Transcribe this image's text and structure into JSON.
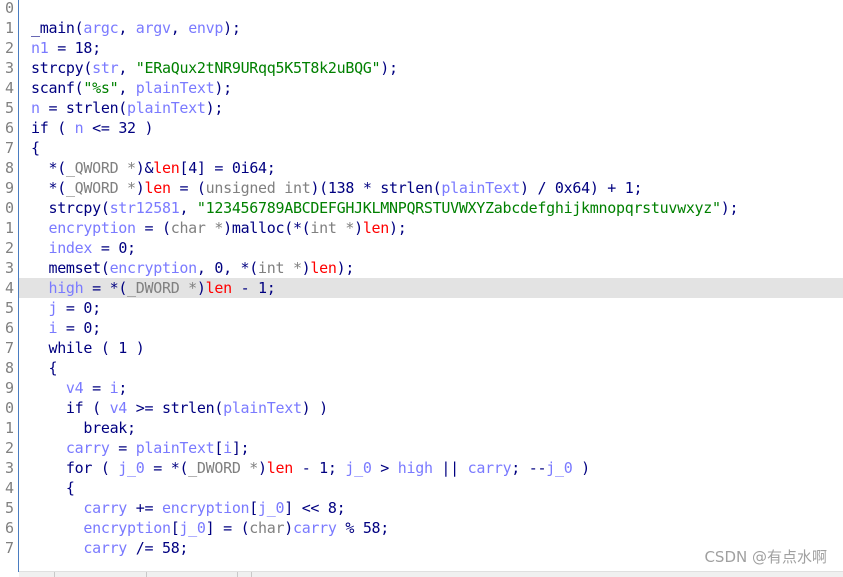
{
  "highlighted_line": 14,
  "colors": {
    "keyword": "#000080",
    "variable": "#7a7aff",
    "string": "#008000",
    "type": "#808080",
    "global": "#ff0000",
    "highlight": "#e3e3e3"
  },
  "line_numbers": [
    "0",
    "1",
    "2",
    "3",
    "4",
    "5",
    "6",
    "7",
    "8",
    "9",
    "0",
    "1",
    "2",
    "3",
    "4",
    "5",
    "6",
    "7",
    "8",
    "9",
    "0",
    "1",
    "2",
    "3",
    "4",
    "5",
    "6",
    "7"
  ],
  "lines": [
    [],
    [
      [
        "k",
        "_main("
      ],
      [
        "v",
        "argc"
      ],
      [
        "k",
        ", "
      ],
      [
        "v",
        "argv"
      ],
      [
        "k",
        ", "
      ],
      [
        "v",
        "envp"
      ],
      [
        "k",
        ");"
      ]
    ],
    [
      [
        "v",
        "n1"
      ],
      [
        "k",
        " = 18;"
      ]
    ],
    [
      [
        "k",
        "strcpy("
      ],
      [
        "v",
        "str"
      ],
      [
        "k",
        ", "
      ],
      [
        "s",
        "\"ERaQux2tNR9URqq5K5T8k2uBQG\""
      ],
      [
        "k",
        ");"
      ]
    ],
    [
      [
        "k",
        "scanf("
      ],
      [
        "s",
        "\"%s\""
      ],
      [
        "k",
        ", "
      ],
      [
        "v",
        "plainText"
      ],
      [
        "k",
        ");"
      ]
    ],
    [
      [
        "v",
        "n"
      ],
      [
        "k",
        " = strlen("
      ],
      [
        "v",
        "plainText"
      ],
      [
        "k",
        ");"
      ]
    ],
    [
      [
        "k",
        "if ( "
      ],
      [
        "v",
        "n"
      ],
      [
        "k",
        " <= 32 )"
      ]
    ],
    [
      [
        "k",
        "{"
      ]
    ],
    [
      [
        "k",
        "  *("
      ],
      [
        "g",
        "_QWORD *"
      ],
      [
        "k",
        ")&"
      ],
      [
        "r",
        "len"
      ],
      [
        "k",
        "[4] = 0i64;"
      ]
    ],
    [
      [
        "k",
        "  *("
      ],
      [
        "g",
        "_QWORD *"
      ],
      [
        "k",
        ")"
      ],
      [
        "r",
        "len"
      ],
      [
        "k",
        " = ("
      ],
      [
        "g",
        "unsigned int"
      ],
      [
        "k",
        ")(138 * strlen("
      ],
      [
        "v",
        "plainText"
      ],
      [
        "k",
        ") / 0x64) + 1;"
      ]
    ],
    [
      [
        "k",
        "  strcpy("
      ],
      [
        "v",
        "str12581"
      ],
      [
        "k",
        ", "
      ],
      [
        "s",
        "\"123456789ABCDEFGHJKLMNPQRSTUVWXYZabcdefghijkmnopqrstuvwxyz\""
      ],
      [
        "k",
        ");"
      ]
    ],
    [
      [
        "v",
        "  encryption"
      ],
      [
        "k",
        " = ("
      ],
      [
        "g",
        "char *"
      ],
      [
        "k",
        ")malloc(*("
      ],
      [
        "g",
        "int *"
      ],
      [
        "k",
        ")"
      ],
      [
        "r",
        "len"
      ],
      [
        "k",
        ");"
      ]
    ],
    [
      [
        "v",
        "  index"
      ],
      [
        "k",
        " = 0;"
      ]
    ],
    [
      [
        "k",
        "  memset("
      ],
      [
        "v",
        "encryption"
      ],
      [
        "k",
        ", 0, *("
      ],
      [
        "g",
        "int *"
      ],
      [
        "k",
        ")"
      ],
      [
        "r",
        "len"
      ],
      [
        "k",
        ");"
      ]
    ],
    [
      [
        "v",
        "  high"
      ],
      [
        "k",
        " = *("
      ],
      [
        "g",
        "_DWORD *"
      ],
      [
        "k",
        ")"
      ],
      [
        "r",
        "len"
      ],
      [
        "k",
        " - 1;"
      ]
    ],
    [
      [
        "v",
        "  j"
      ],
      [
        "k",
        " = 0;"
      ]
    ],
    [
      [
        "v",
        "  i"
      ],
      [
        "k",
        " = 0;"
      ]
    ],
    [
      [
        "k",
        "  while ( 1 )"
      ]
    ],
    [
      [
        "k",
        "  {"
      ]
    ],
    [
      [
        "v",
        "    v4"
      ],
      [
        "k",
        " = "
      ],
      [
        "v",
        "i"
      ],
      [
        "k",
        ";"
      ]
    ],
    [
      [
        "k",
        "    if ( "
      ],
      [
        "v",
        "v4"
      ],
      [
        "k",
        " >= strlen("
      ],
      [
        "v",
        "plainText"
      ],
      [
        "k",
        ") )"
      ]
    ],
    [
      [
        "k",
        "      break;"
      ]
    ],
    [
      [
        "v",
        "    carry"
      ],
      [
        "k",
        " = "
      ],
      [
        "v",
        "plainText"
      ],
      [
        "k",
        "["
      ],
      [
        "v",
        "i"
      ],
      [
        "k",
        "];"
      ]
    ],
    [
      [
        "k",
        "    for ( "
      ],
      [
        "v",
        "j_0"
      ],
      [
        "k",
        " = *("
      ],
      [
        "g",
        "_DWORD *"
      ],
      [
        "k",
        ")"
      ],
      [
        "r",
        "len"
      ],
      [
        "k",
        " - 1; "
      ],
      [
        "v",
        "j_0"
      ],
      [
        "k",
        " > "
      ],
      [
        "v",
        "high"
      ],
      [
        "k",
        " || "
      ],
      [
        "v",
        "carry"
      ],
      [
        "k",
        "; --"
      ],
      [
        "v",
        "j_0"
      ],
      [
        "k",
        " )"
      ]
    ],
    [
      [
        "k",
        "    {"
      ]
    ],
    [
      [
        "v",
        "      carry"
      ],
      [
        "k",
        " += "
      ],
      [
        "v",
        "encryption"
      ],
      [
        "k",
        "["
      ],
      [
        "v",
        "j_0"
      ],
      [
        "k",
        "] << 8;"
      ]
    ],
    [
      [
        "v",
        "      encryption"
      ],
      [
        "k",
        "["
      ],
      [
        "v",
        "j_0"
      ],
      [
        "k",
        "] = ("
      ],
      [
        "g",
        "char"
      ],
      [
        "k",
        ")"
      ],
      [
        "v",
        "carry"
      ],
      [
        "k",
        " % 58;"
      ]
    ],
    [
      [
        "v",
        "      carry"
      ],
      [
        "k",
        " /= 58;"
      ]
    ]
  ],
  "watermark": "CSDN @有点水啊"
}
